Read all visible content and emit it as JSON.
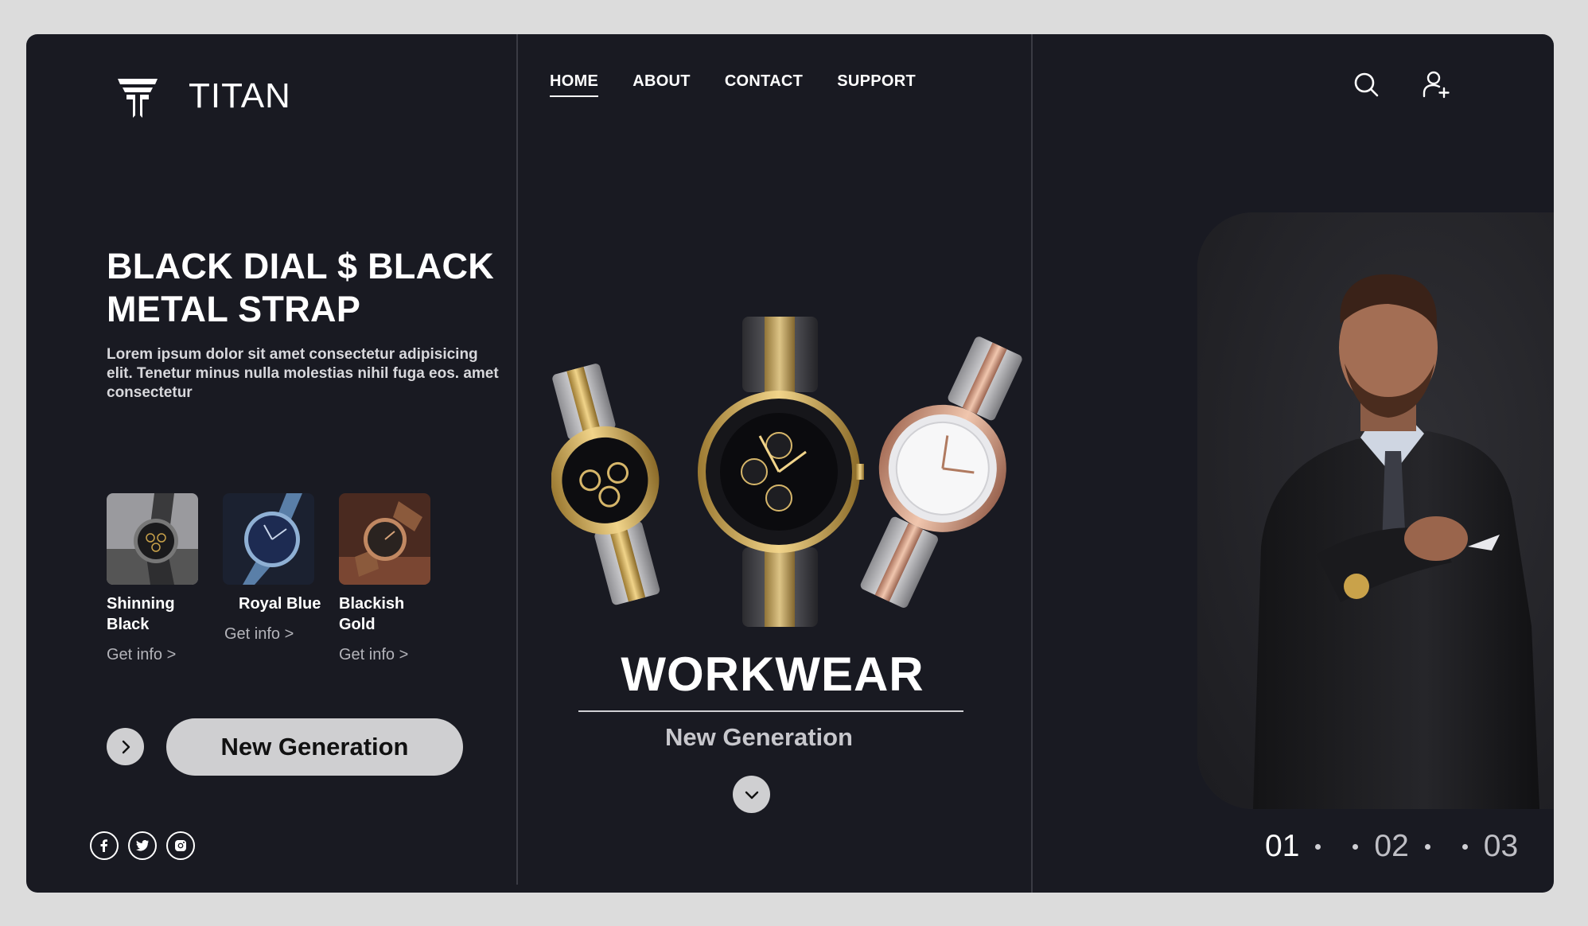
{
  "brand": {
    "name": "TITAN",
    "logo_icon": "titan-t-logo-icon"
  },
  "nav": {
    "items": [
      {
        "label": "HOME",
        "active": true
      },
      {
        "label": "ABOUT",
        "active": false
      },
      {
        "label": "CONTACT",
        "active": false
      },
      {
        "label": "SUPPORT",
        "active": false
      }
    ]
  },
  "header_icons": {
    "search": "search-icon",
    "user": "add-user-icon"
  },
  "hero": {
    "headline": "BLACK DIAL $ BLACK METAL STRAP",
    "description": "Lorem ipsum dolor sit amet consectetur adipisicing elit. Tenetur minus nulla molestias nihil fuga eos. amet consectetur"
  },
  "products": [
    {
      "name": "Shinning Black",
      "link": "Get info >"
    },
    {
      "name": "Royal Blue",
      "link": "Get info >"
    },
    {
      "name": "Blackish Gold",
      "link": "Get info >"
    }
  ],
  "cta": {
    "label": "New Generation",
    "arrow_icon": "chevron-right-icon"
  },
  "social": [
    "facebook-icon",
    "twitter-icon",
    "instagram-icon"
  ],
  "feature": {
    "title": "WORKWEAR",
    "subtitle": "New Generation",
    "down_icon": "chevron-down-icon"
  },
  "pager": {
    "items": [
      "01",
      "02",
      "03"
    ],
    "active": "01"
  },
  "colors": {
    "background": "#191a22",
    "page": "#dcdcdc",
    "button": "#cfcfd1",
    "accent_gold": "#c9a24a"
  }
}
